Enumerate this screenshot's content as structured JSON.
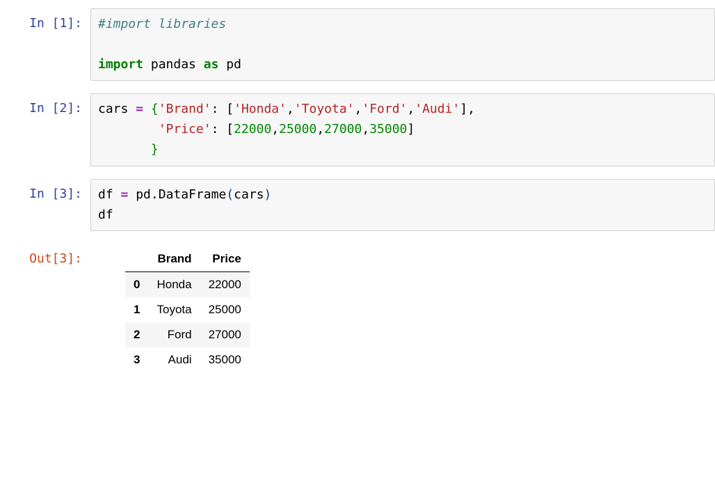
{
  "cells": [
    {
      "prompt_in": "In [1]:",
      "code_html": "<span class=\"cm\">#import libraries</span>\n\n<span class=\"kw\">import</span> <span class=\"nm\">pandas</span> <span class=\"kw\">as</span> <span class=\"nm\">pd</span>"
    },
    {
      "prompt_in": "In [2]:",
      "code_html": "<span class=\"nm\">cars</span> <span class=\"op\">=</span> <span class=\"brace\">{</span><span class=\"str\">'Brand'</span><span class=\"opc\">:</span> <span class=\"opc\">[</span><span class=\"str\">'Honda'</span><span class=\"opc\">,</span><span class=\"str\">'Toyota'</span><span class=\"opc\">,</span><span class=\"str\">'Ford'</span><span class=\"opc\">,</span><span class=\"str\">'Audi'</span><span class=\"opc\">],</span>\n        <span class=\"str\">'Price'</span><span class=\"opc\">:</span> <span class=\"opc\">[</span><span class=\"num\">22000</span><span class=\"opc\">,</span><span class=\"num\">25000</span><span class=\"opc\">,</span><span class=\"num\">27000</span><span class=\"opc\">,</span><span class=\"num\">35000</span><span class=\"opc\">]</span>\n       <span class=\"brace\">}</span>"
    },
    {
      "prompt_in": "In [3]:",
      "code_html": "<span class=\"nm\">df</span> <span class=\"op\">=</span> <span class=\"nm\">pd</span><span class=\"opc\">.</span><span class=\"nm\">DataFrame</span><span class=\"paren\">(</span><span class=\"nm\">cars</span><span class=\"paren\">)</span>\n<span class=\"nm\">df</span>",
      "prompt_out": "Out[3]:",
      "output_table": {
        "columns": [
          "Brand",
          "Price"
        ],
        "rows": [
          {
            "idx": "0",
            "Brand": "Honda",
            "Price": "22000"
          },
          {
            "idx": "1",
            "Brand": "Toyota",
            "Price": "25000"
          },
          {
            "idx": "2",
            "Brand": "Ford",
            "Price": "27000"
          },
          {
            "idx": "3",
            "Brand": "Audi",
            "Price": "35000"
          }
        ]
      }
    }
  ]
}
